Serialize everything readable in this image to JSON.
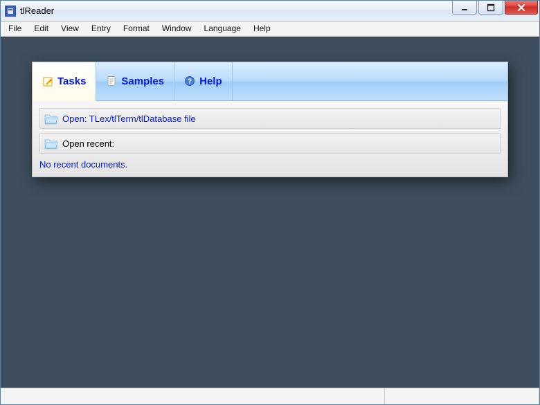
{
  "window": {
    "title": "tlReader"
  },
  "menu": {
    "items": [
      "File",
      "Edit",
      "View",
      "Entry",
      "Format",
      "Window",
      "Language",
      "Help"
    ]
  },
  "tabs": {
    "items": [
      {
        "label": "Tasks",
        "icon": "edit-icon"
      },
      {
        "label": "Samples",
        "icon": "page-icon"
      },
      {
        "label": "Help",
        "icon": "help-icon"
      }
    ],
    "active_index": 0
  },
  "tasks": {
    "open_label": "Open: TLex/tlTerm/tlDatabase file",
    "open_recent_label": "Open recent:",
    "no_recent_label": "No recent documents."
  }
}
